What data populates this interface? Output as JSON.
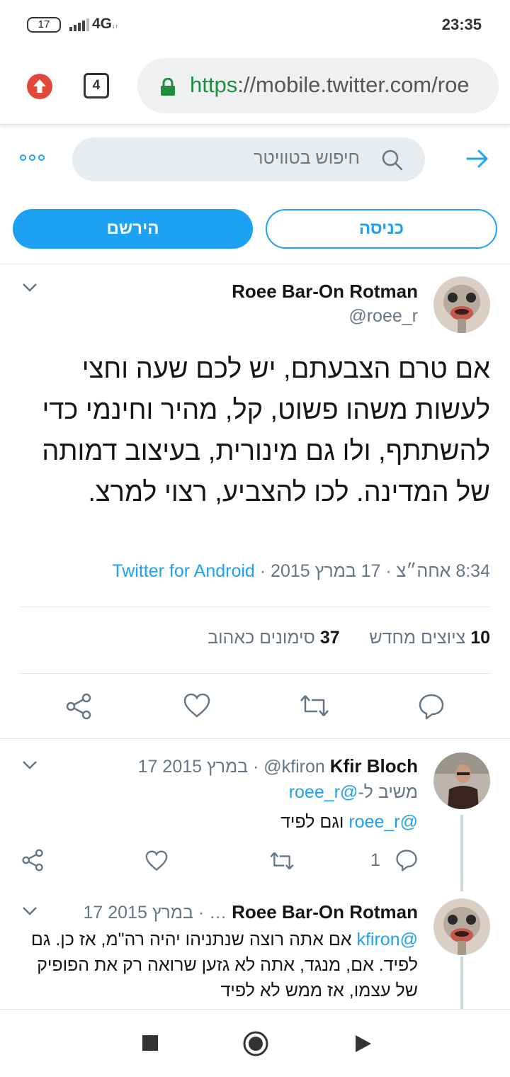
{
  "status_bar": {
    "battery": "17",
    "network": "4G",
    "time": "23:35"
  },
  "browser": {
    "tab_count": "4",
    "url_protocol": "https",
    "url_rest": "://mobile.twitter.com/roe"
  },
  "header": {
    "search_placeholder": "חיפוש בטוויטר"
  },
  "buttons": {
    "signup": "הירשם",
    "login": "כניסה"
  },
  "tweet": {
    "name": "Roee Bar-On Rotman",
    "handle": "@roee_r",
    "text": "אם טרם הצבעתם, יש לכם שעה וחצי לעשות משהו פשוט, קל, מהיר וחינמי כדי להשתתף, ולו גם מינורית, בעיצוב דמותה של המדינה. לכו להצביע, רצוי למרצ.",
    "time": "8:34 אחה״צ · 17 במרץ 2015 · ",
    "source": "Twitter for Android",
    "retweets_count": "10",
    "retweets_label": "ציוצים מחדש",
    "likes_count": "37",
    "likes_label": "סימונים כאהוב"
  },
  "replies": [
    {
      "name": "Kfir Bloch",
      "handle": "@kfiron",
      "date": "17 במרץ 2015",
      "replying_to_label": "משיב ל-",
      "replying_to_handle": "@roee_r",
      "mention": "@roee_r",
      "text": "וגם לפיד",
      "reply_count": "1"
    },
    {
      "name": "Roee Bar-On Rotman",
      "handle": "…",
      "date": "17 במרץ 2015",
      "mention": "@kfiron",
      "text": "אם אתה רוצה שנתניהו יהיה רה\"מ, אז כן. גם לפיד. אם, מנגד, אתה לא גזען שרואה רק את הפופיק של עצמו, אז ממש לא לפיד"
    }
  ],
  "colors": {
    "accent": "#1da1f2",
    "secure": "#1e8e3e",
    "muted": "#657786"
  }
}
